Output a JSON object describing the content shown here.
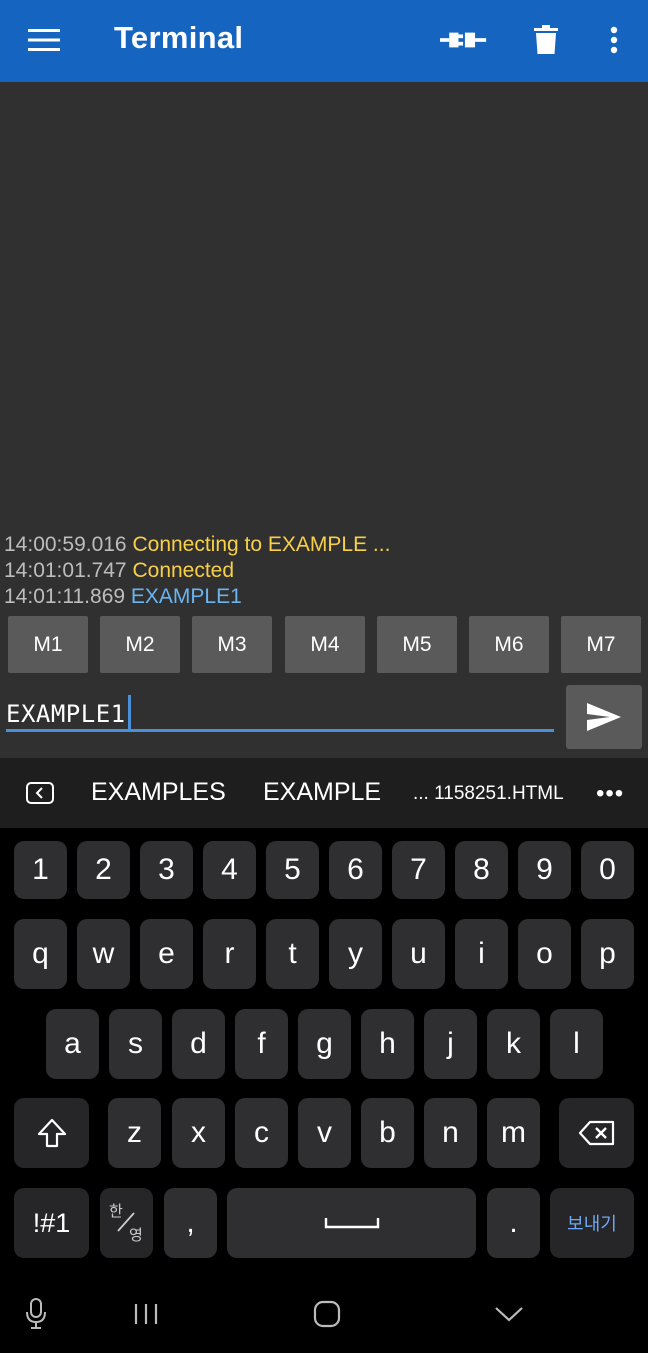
{
  "appbar": {
    "title": "Terminal",
    "icons": [
      "menu-icon",
      "connect-plug-icon",
      "trash-icon",
      "more-vert-icon"
    ]
  },
  "colors": {
    "appbar": "#1565c0",
    "terminal_bg": "#303030",
    "timestamp": "#bdbdbd",
    "status_text": "#f7d047",
    "received_text": "#6ab4f0",
    "accent": "#4a90d9"
  },
  "log": [
    {
      "time": "14:00:59.016",
      "text": "Connecting to EXAMPLE ..."
    },
    {
      "time": "14:01:01.747",
      "text": "Connected"
    },
    {
      "time": "14:01:11.869",
      "text": "EXAMPLE1"
    }
  ],
  "macros": [
    "M1",
    "M2",
    "M3",
    "M4",
    "M5",
    "M6",
    "M7"
  ],
  "input": {
    "value": "EXAMPLE1"
  },
  "suggestions": {
    "items": [
      "EXAMPLES",
      "EXAMPLE",
      "... 1158251.HTML"
    ],
    "more": "•••"
  },
  "keyboard": {
    "numbers": [
      "1",
      "2",
      "3",
      "4",
      "5",
      "6",
      "7",
      "8",
      "9",
      "0"
    ],
    "row1": [
      "q",
      "w",
      "e",
      "r",
      "t",
      "y",
      "u",
      "i",
      "o",
      "p"
    ],
    "row2": [
      "a",
      "s",
      "d",
      "f",
      "g",
      "h",
      "j",
      "k",
      "l"
    ],
    "row3": [
      "z",
      "x",
      "c",
      "v",
      "b",
      "n",
      "m"
    ],
    "symbols": "!#1",
    "lang_top": "한",
    "lang_bottom": "영",
    "comma": ",",
    "period": ".",
    "send": "보내기"
  }
}
